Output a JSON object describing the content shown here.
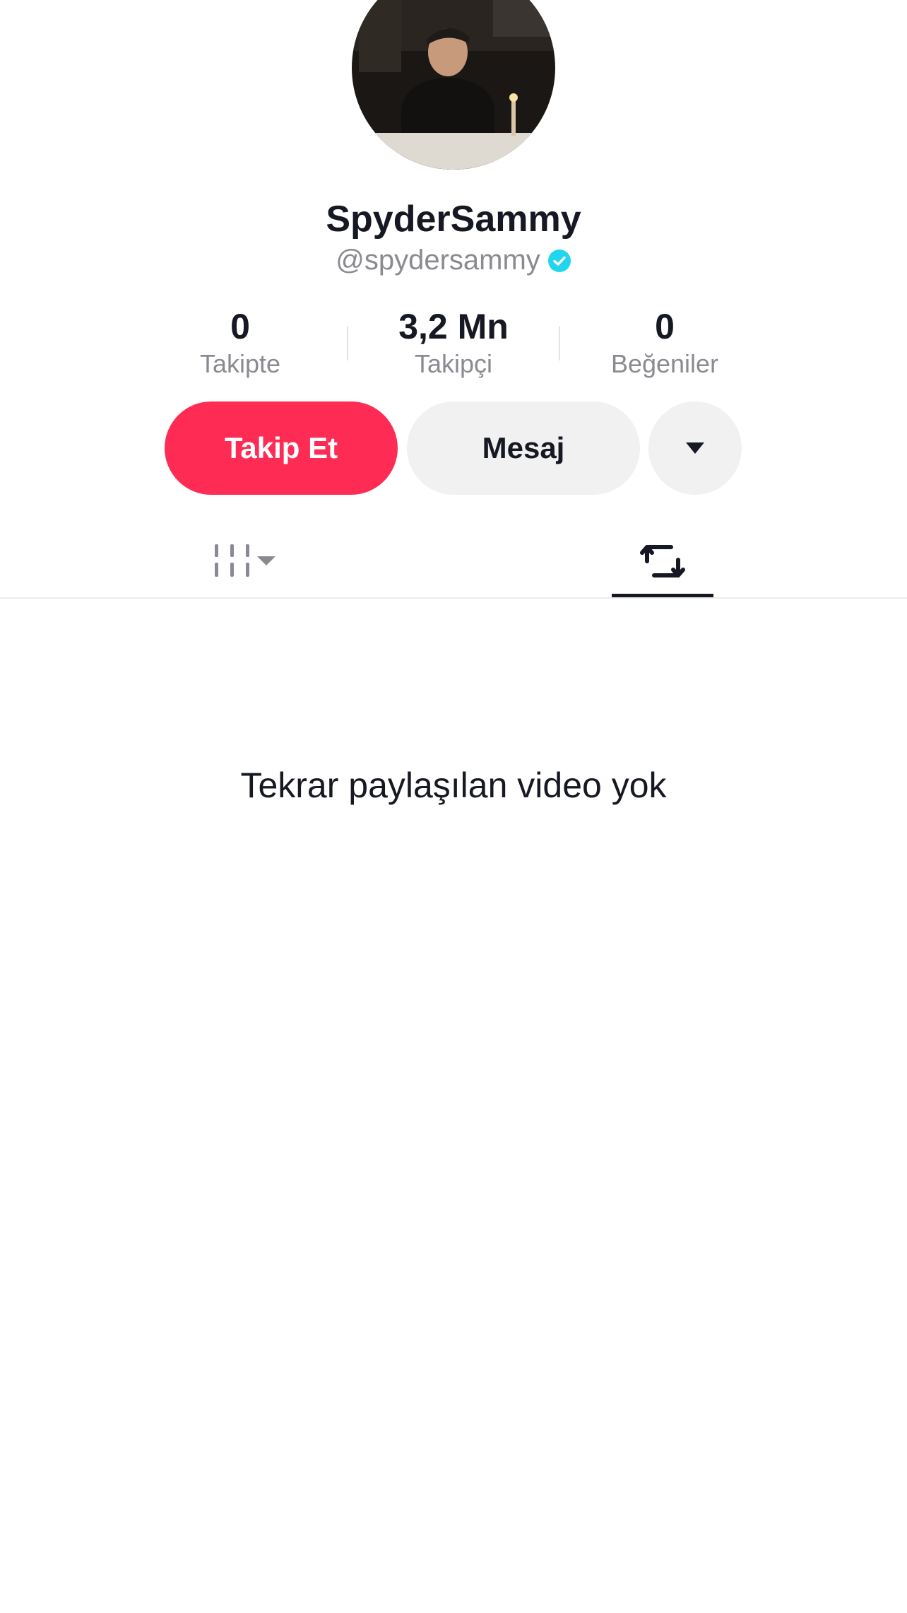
{
  "profile": {
    "display_name": "SpyderSammy",
    "handle": "@spydersammy",
    "verified": true,
    "verified_color": "#20d5ec"
  },
  "stats": [
    {
      "value": "0",
      "label": "Takipte"
    },
    {
      "value": "3,2 Mn",
      "label": "Takipçi"
    },
    {
      "value": "0",
      "label": "Beğeniler"
    }
  ],
  "actions": {
    "follow_label": "Takip Et",
    "follow_color": "#fe2c55",
    "message_label": "Mesaj",
    "more_icon": "caret-down-icon"
  },
  "tabs": [
    {
      "icon": "videos-grid-icon",
      "has_dropdown": true,
      "active": false
    },
    {
      "icon": "repost-icon",
      "active": true
    }
  ],
  "empty_state": {
    "message": "Tekrar paylaşılan video yok"
  }
}
